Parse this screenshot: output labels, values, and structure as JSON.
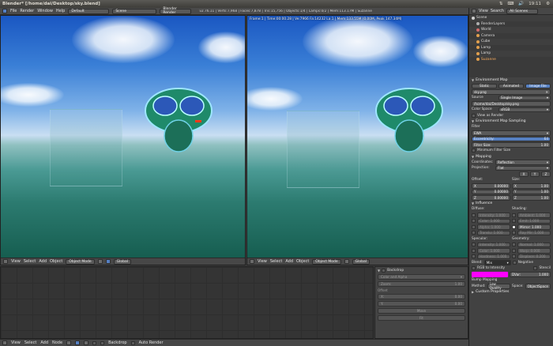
{
  "os_titlebar": {
    "title": "Blender* [/home/dai/Desktop/sky.blend]",
    "time": "19:11"
  },
  "info_header": {
    "menus": [
      "File",
      "Render",
      "Window",
      "Help"
    ],
    "layout": "Default",
    "scene": "Scene",
    "engine": "Blender Render",
    "stats": "v2.76.11 | Verts:7,968 | Faces:7,878 | Tris:15,756 | Objects:1/4 | Lamps:0/2 | Mem:113.17M | Suzanne"
  },
  "viewports": {
    "right_label": "Frame:1 | Time:00:00.28 | Ve:7966 Fa:14232 La:1 | Mem:133.55M (0.00M, Peak 147.34M)",
    "header_menus": [
      "View",
      "Select",
      "Add",
      "Object"
    ],
    "mode": "Object Mode",
    "orientation": "Global"
  },
  "node_editor": {
    "panel_title": "Backdrop",
    "channels": "Color and Alpha",
    "zoom_label": "Zoom:",
    "zoom_value": "1.00",
    "offset_label": "Offset",
    "x_label": "X:",
    "x_value": "0.00",
    "y_label": "Y:",
    "y_value": "0.00",
    "move_label": "Move",
    "fit_label": "Fit"
  },
  "bottom_bar": {
    "menus": [
      "View",
      "Select",
      "Add",
      "Node"
    ],
    "backdrop": "Backdrop",
    "auto_render": "Auto Render"
  },
  "outliner": {
    "view_menus": [
      "View",
      "Search"
    ],
    "filter": "All Scenes",
    "items": [
      "Scene",
      "RenderLayers",
      "World",
      "Camera",
      "Cube",
      "Lamp",
      "Lamp",
      "Suzanne"
    ]
  },
  "properties": {
    "env_map_section": "Environment Map",
    "env_tabs": [
      "Static",
      "Animated",
      "Image File"
    ],
    "sky_file": "sky.png",
    "source_label": "Source",
    "source_value": "Single Image",
    "file_path": "/home/dai/Desktop/sky.png",
    "color_space_label": "Color Space",
    "color_space_value": "sRGB",
    "view_as_render": "View as Render",
    "sampling_section": "Environment Map Sampling",
    "filter_label": "Filter",
    "filter_value": "EWA",
    "eccentricity_label": "Eccentricity:",
    "eccentricity_value": "64",
    "filter_size_label": "Filter Size:",
    "filter_size_value": "1.00",
    "min_filter_size": "Minimum Filter Size",
    "mapping_section": "Mapping",
    "coordinates_label": "Coordinates:",
    "coordinates_value": "Reflection",
    "projection_label": "Projection:",
    "projection_value": "Flat",
    "xyz": [
      "X",
      "Y",
      "Z"
    ],
    "offset_label": "Offset:",
    "size_label": "Size:",
    "offset_x": "0.00000",
    "offset_y": "0.00000",
    "offset_z": "0.00000",
    "size_x": "1.00",
    "size_y": "1.00",
    "size_z": "1.00",
    "influence_section": "Influence",
    "diffuse_label": "Diffuse:",
    "shading_label": "Shading:",
    "intensity": "Intensity: 1.000",
    "color": "Color: 1.000",
    "alpha": "Alpha: 1.000",
    "translucency": "Translu: 1.000",
    "ambient": "Ambient: 1.000",
    "emit": "Emit: 1.000",
    "mirror": "Mirror: 1.000",
    "ray_mirror": "Ray Mir: 1.000",
    "specular_label": "Specular:",
    "geometry_label": "Geometry:",
    "spec_intensity": "Intensity: 1.000",
    "spec_color": "Color: 1.000",
    "hardness": "Hardness: 1.000",
    "normal": "Normal: 1.000",
    "warp": "Warp: 0.000",
    "displace": "Displace: 0.200",
    "blend_label": "Blend:",
    "blend_value": "Mix",
    "negative": "Negative",
    "rgb_to_intensity": "RGB to Intensity",
    "stencil": "Stencil",
    "dvar_label": "DVar:",
    "dvar_value": "1.000",
    "bump_section": "Bump Mapping",
    "method_label": "Method:",
    "method_value": "Low Quality",
    "space_label": "Space:",
    "space_value": "ObjectSpace",
    "custom_props": "Custom Properties",
    "magenta": "#ff00ff"
  }
}
